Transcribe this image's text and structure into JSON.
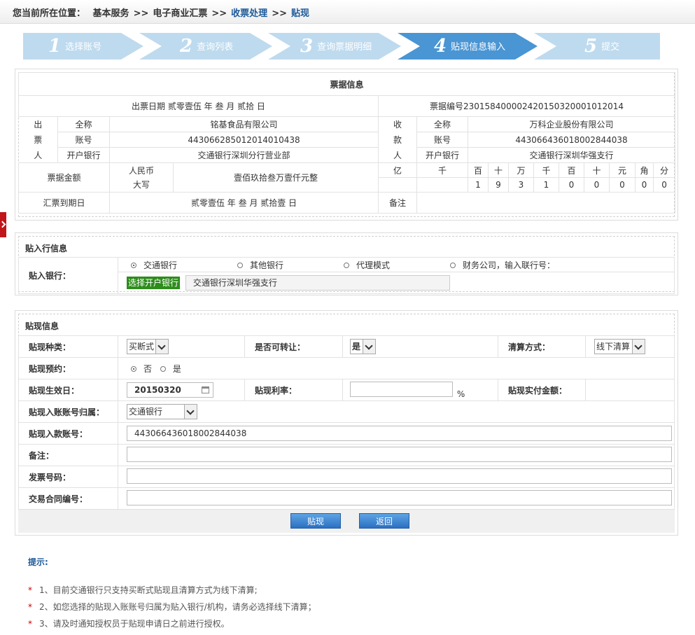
{
  "breadcrumb": {
    "prefix": "您当前所在位置：",
    "items": [
      "基本服务",
      "电子商业汇票",
      "收票处理",
      "贴现"
    ],
    "separator": ">>"
  },
  "steps": [
    {
      "num": "1",
      "label": "选择账号"
    },
    {
      "num": "2",
      "label": "查询列表"
    },
    {
      "num": "3",
      "label": "查询票据明细"
    },
    {
      "num": "4",
      "label": "贴现信息输入"
    },
    {
      "num": "5",
      "label": "提交"
    }
  ],
  "active_step": 4,
  "bill": {
    "title": "票据信息",
    "issue_date": "出票日期 贰零壹伍 年 叁 月 贰拾 日",
    "bill_no": "票据编号230158400002420150320001012014",
    "drawer_label": [
      "出",
      "票",
      "人"
    ],
    "payee_label": [
      "收",
      "款",
      "人"
    ],
    "field_fullname": "全称",
    "field_account": "账号",
    "field_bank": "开户银行",
    "drawer": {
      "fullname": "铭基食品有限公司",
      "account": "443066285012014010438",
      "bank": "交通银行深圳分行营业部"
    },
    "payee": {
      "fullname": "万科企业股份有限公司",
      "account": "443066436018002844038",
      "bank": "交通银行深圳华强支行"
    },
    "amount_label": "票据金额",
    "rmb_label": "人民币",
    "daxie_label": "大写",
    "amount_words": "壹佰玖拾叁万壹仟元整",
    "digit_headers": [
      "亿",
      "千",
      "百",
      "十",
      "万",
      "千",
      "百",
      "十",
      "元",
      "角",
      "分"
    ],
    "digits": [
      "",
      "",
      "1",
      "9",
      "3",
      "1",
      "0",
      "0",
      "0",
      "0",
      "0"
    ],
    "due_label": "汇票到期日",
    "due_date": "贰零壹伍 年 叁 月 贰拾壹 日",
    "remark_label": "备注",
    "remark": ""
  },
  "bank_info": {
    "title": "贴入行信息",
    "bank_label": "贴入银行：",
    "options": [
      "交通银行",
      "其他银行",
      "代理模式",
      "财务公司，输入联行号："
    ],
    "selected": 0,
    "choose_btn": "选择开户银行",
    "bank_value": "交通银行深圳华强支行"
  },
  "discount": {
    "title": "贴现信息",
    "type_label": "贴现种类：",
    "type_value": "买断式",
    "transfer_label": "是否可转让：",
    "transfer_value": "是",
    "clear_label": "清算方式：",
    "clear_value": "线下清算",
    "reserve_label": "贴现预约：",
    "reserve_no": "否",
    "reserve_yes": "是",
    "reserve_selected": "否",
    "effective_label": "贴现生效日：",
    "effective_value": "20150320",
    "rate_label": "贴现利率：",
    "rate_value": "",
    "rate_unit": "%",
    "actual_label": "贴现实付金额：",
    "actual_value": "",
    "acct_belong_label": "贴现入账账号归属：",
    "acct_belong_value": "交通银行",
    "acct_label": "贴现入款账号：",
    "acct_value": "443066436018002844038",
    "remark_label": "备注：",
    "remark_value": "",
    "invoice_label": "发票号码：",
    "invoice_value": "",
    "contract_label": "交易合同编号：",
    "contract_value": ""
  },
  "buttons": {
    "submit": "贴现",
    "back": "返回"
  },
  "tips": {
    "title": "提示:",
    "lines": [
      "1、目前交通银行只支持买断式贴现且清算方式为线下清算;",
      "2、如您选择的贴现入账账号归属为贴入银行/机构，请务必选择线下清算；",
      "3、请及时通知授权员于贴现申请日之前进行授权。"
    ]
  }
}
